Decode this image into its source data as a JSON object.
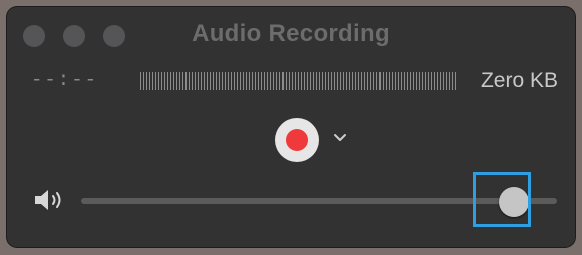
{
  "window": {
    "title": "Audio Recording"
  },
  "recording": {
    "elapsed_time": "--:--",
    "file_size": "Zero KB",
    "record_label": "record",
    "options_label": "recording options"
  },
  "volume": {
    "level": 0.91
  },
  "colors": {
    "record_dot": "#f0393a",
    "highlight": "#2f9fe4"
  },
  "icons": [
    "close-icon",
    "minimize-icon",
    "zoom-icon",
    "record-icon",
    "chevron-down-icon",
    "speaker-icon"
  ]
}
